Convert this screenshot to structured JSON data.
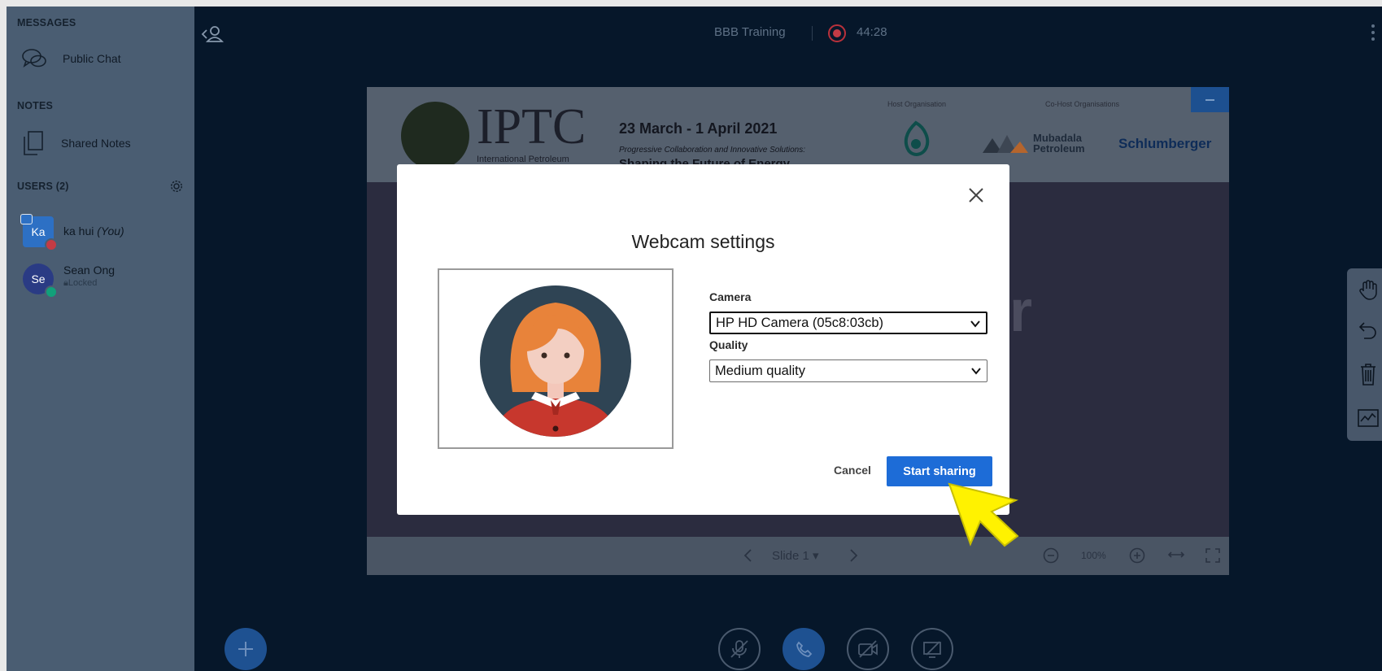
{
  "sidebar": {
    "messages_header": "MESSAGES",
    "public_chat": "Public Chat",
    "notes_header": "NOTES",
    "shared_notes": "Shared Notes",
    "users_header": "USERS (2)",
    "users": [
      {
        "initials": "Ka",
        "name": "ka hui",
        "you": "(You)",
        "sub": ""
      },
      {
        "initials": "Se",
        "name": "Sean Ong",
        "you": "",
        "sub": "Locked"
      }
    ]
  },
  "topbar": {
    "title": "BBB Training",
    "recording_time": "44:28"
  },
  "slide": {
    "logo": "IPTC",
    "logo_sub": "International Petroleum",
    "date": "23 March - 1 April 2021",
    "tagline": "Progressive Collaboration and Innovative Solutions:",
    "tagline_bold": "Shaping the Future of Energy",
    "host_label": "Host Organisation",
    "cohost_label": "Co-Host Organisations",
    "mubadala": "Mubadala\nPetroleum",
    "schlumberger": "Schlumberger",
    "bg_letter": "r",
    "slide_label": "Slide 1",
    "zoom": "100%"
  },
  "modal": {
    "title": "Webcam settings",
    "camera_label": "Camera",
    "camera_value": "HP HD Camera (05c8:03cb)",
    "quality_label": "Quality",
    "quality_value": "Medium quality",
    "cancel": "Cancel",
    "start": "Start sharing"
  },
  "colors": {
    "accent": "#1d6cd7",
    "sidebar": "#4a5d72",
    "background": "#06172a",
    "cursor": "#fff200"
  },
  "icons": [
    "chat-icon",
    "notes-icon",
    "gear-icon",
    "collapse-users-icon",
    "record-icon",
    "more-icon",
    "hand-icon",
    "undo-icon",
    "trash-icon",
    "multi-user-icon",
    "plus-icon",
    "mic-off-icon",
    "phone-icon",
    "camera-off-icon",
    "screen-share-off-icon",
    "close-icon",
    "chevron-down-icon"
  ]
}
